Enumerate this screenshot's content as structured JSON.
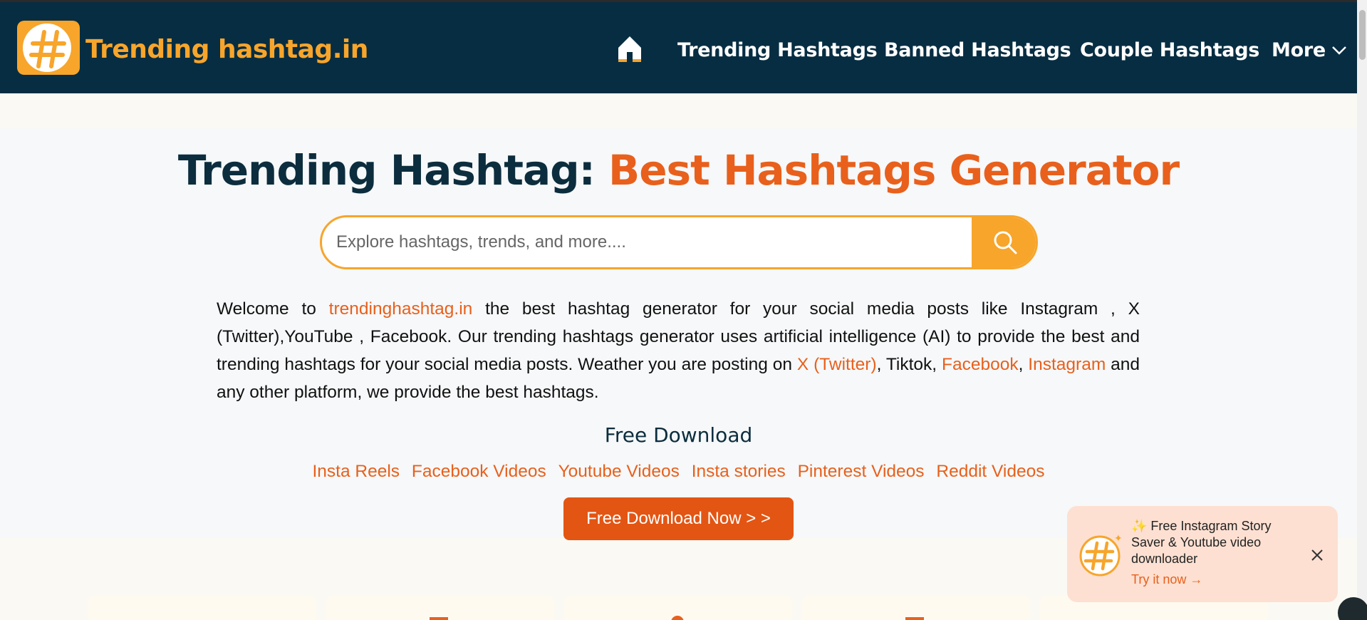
{
  "brand": {
    "name": "Trending hashtag.in",
    "color": "#f7a52b"
  },
  "nav": {
    "home_icon": "home-icon",
    "items": [
      {
        "label": "Trending Hashtags"
      },
      {
        "label": "Banned Hashtags"
      },
      {
        "label": "Couple Hashtags"
      },
      {
        "label": "More"
      }
    ]
  },
  "hero": {
    "title_main": "Trending Hashtag: ",
    "title_accent": "Best Hashtags Generator",
    "accent_color": "#e8601c"
  },
  "search": {
    "placeholder": "Explore hashtags, trends, and more....",
    "icon": "search-icon"
  },
  "intro": {
    "p1": "Welcome to ",
    "link_site": "trendinghashtag.in",
    "p2": " the best hashtag generator for your social media posts like Instagram , X (Twitter),YouTube , Facebook. Our trending hashtags generator uses artificial intelligence (AI) to provide the best and trending hashtags for your social media posts. Weather you are posting on ",
    "link_x": "X (Twitter)",
    "p3": ", Tiktok, ",
    "link_fb": "Facebook",
    "p4": ", ",
    "link_ig": "Instagram",
    "p5": " and any other platform, we provide the best hashtags."
  },
  "free_download": {
    "title": "Free Download",
    "links": [
      "Insta Reels",
      "Facebook Videos",
      "Youtube Videos",
      "Insta stories",
      "Pinterest Videos",
      "Reddit Videos"
    ],
    "button": "Free Download Now > >"
  },
  "toast": {
    "text": "✨ Free Instagram Story Saver & Youtube video downloader",
    "link": "Try it now →",
    "close_icon": "close-icon"
  }
}
